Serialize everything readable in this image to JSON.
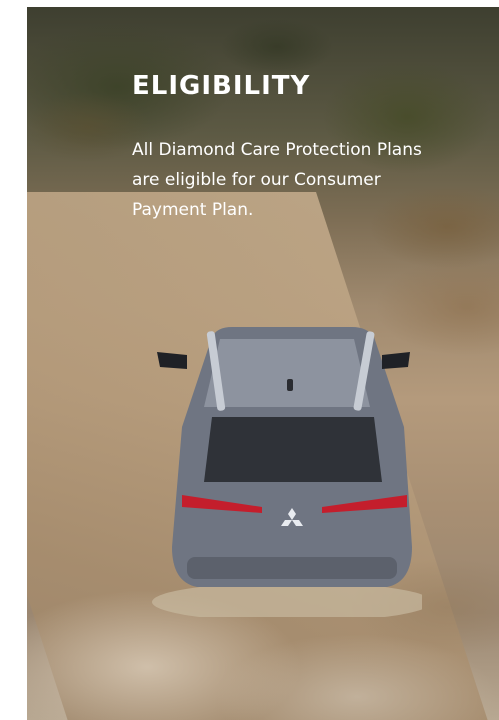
{
  "hero": {
    "heading": "ELIGIBILITY",
    "body": "All Diamond Care Protection Plans are eligible for our Consumer Payment Plan."
  },
  "image": {
    "subject": "SUV driving on dusty dirt road",
    "logo_icon": "mitsubishi-logo-icon"
  }
}
